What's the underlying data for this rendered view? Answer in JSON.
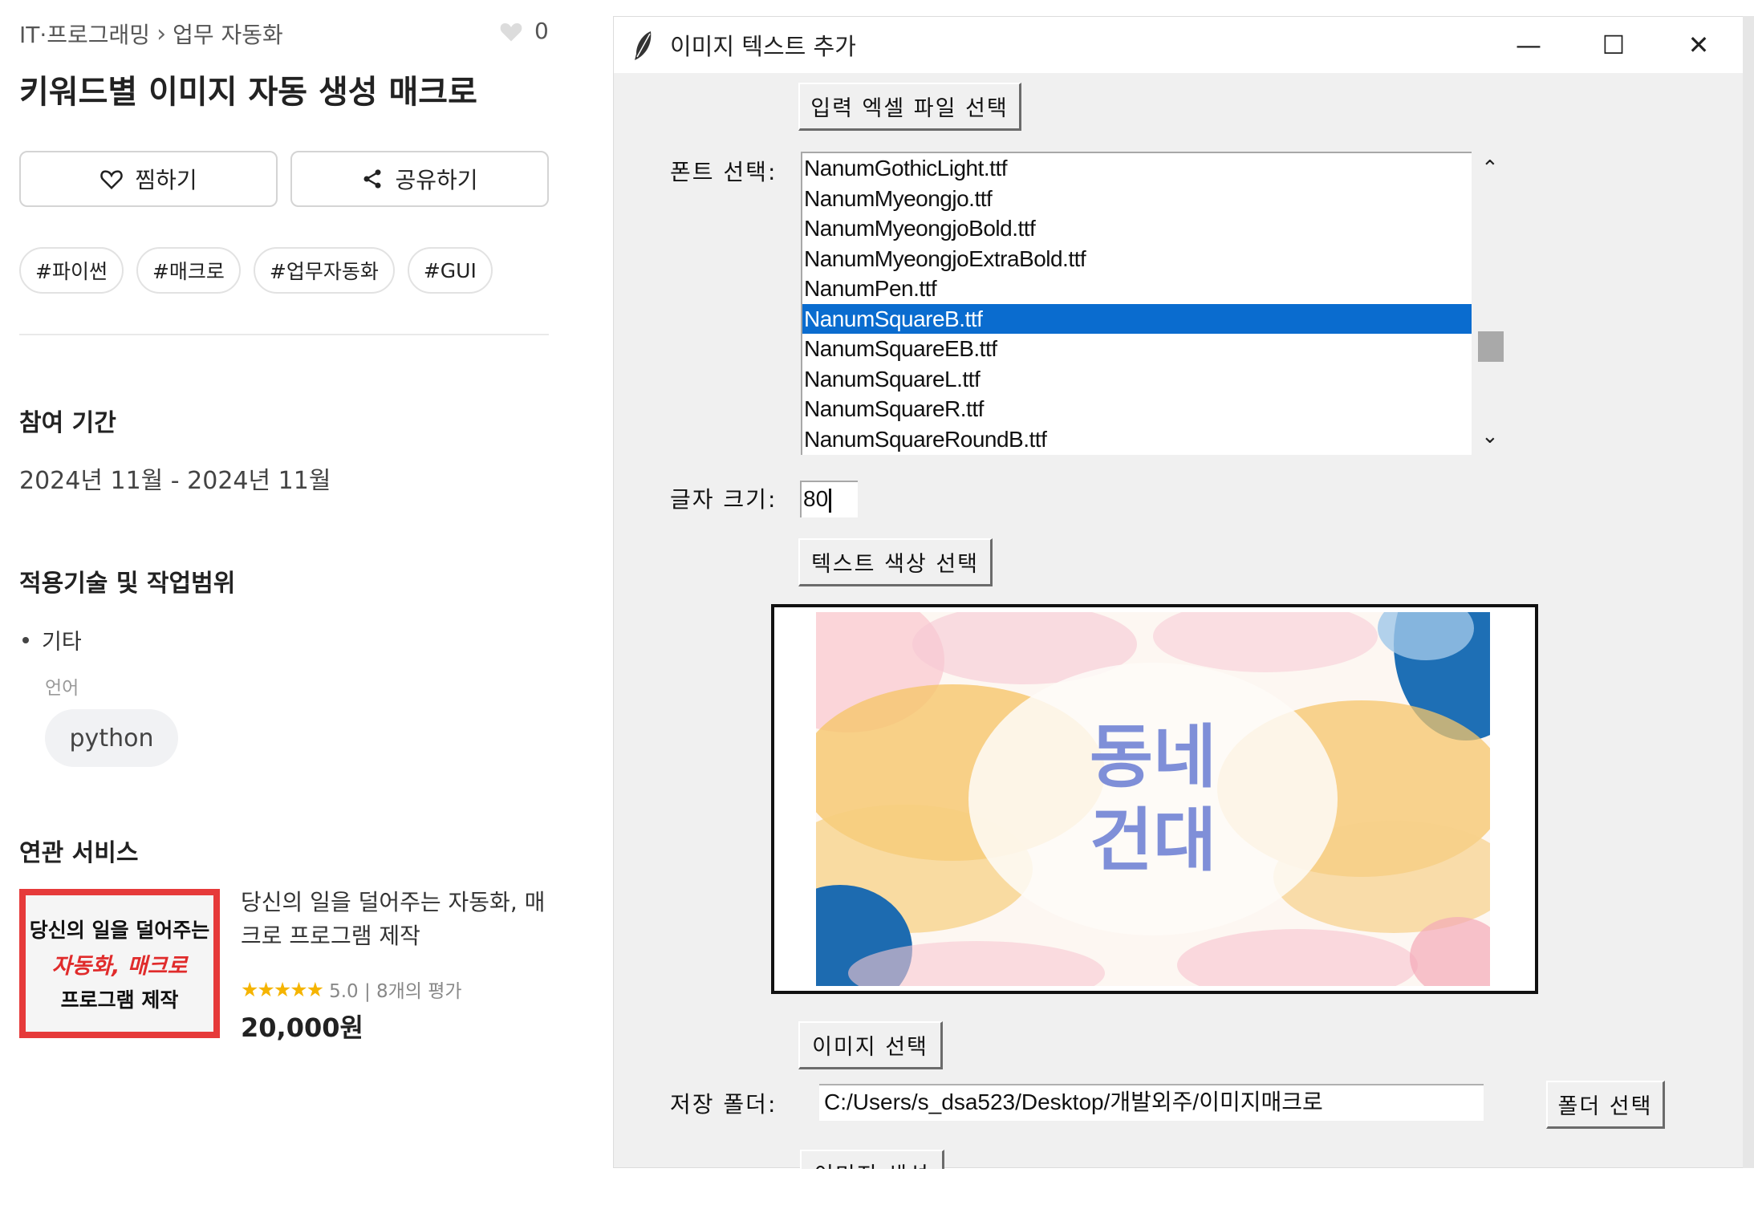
{
  "web": {
    "breadcrumb": {
      "category": "IT·프로그래밍",
      "subcategory": "업무 자동화"
    },
    "like_count": "0",
    "title": "키워드별 이미지 자동 생성 매크로",
    "buttons": {
      "wish": "찜하기",
      "share": "공유하기"
    },
    "tags": [
      "#파이썬",
      "#매크로",
      "#업무자동화",
      "#GUI"
    ],
    "period_heading": "참여 기간",
    "period_value": "2024년 11월 - 2024년 11월",
    "tech_heading": "적용기술 및 작업범위",
    "tech_item": "기타",
    "language_label": "언어",
    "language_value": "python",
    "related_heading": "연관 서비스",
    "related": {
      "thumb_line1": "당신의 일을 덜어주는",
      "thumb_line2": "자동화, 매크로",
      "thumb_line3": "프로그램 제작",
      "title": "당신의 일을 덜어주는 자동화, 매크로 프로그램 제작",
      "stars": "★★★★★",
      "rating": "5.0 | 8개의 평가",
      "price": "20,000원"
    }
  },
  "app": {
    "window_title": "이미지 텍스트 추가",
    "controls": {
      "minimize": "—",
      "maximize": "☐",
      "close": "✕"
    },
    "btn_select_excel": "입력 엑셀 파일 선택",
    "font_label": "폰트 선택:",
    "fonts": [
      "NanumGothicLight.ttf",
      "NanumMyeongjo.ttf",
      "NanumMyeongjoBold.ttf",
      "NanumMyeongjoExtraBold.ttf",
      "NanumPen.ttf",
      "NanumSquareB.ttf",
      "NanumSquareEB.ttf",
      "NanumSquareL.ttf",
      "NanumSquareR.ttf",
      "NanumSquareRoundB.ttf"
    ],
    "selected_font": "NanumSquareB.ttf",
    "size_label": "글자 크기:",
    "size_value": "80",
    "btn_text_color": "텍스트 색상 선택",
    "preview_line1": "동네",
    "preview_line2": "건대",
    "preview_text_color": "#7f8fd8",
    "btn_select_image": "이미지 선택",
    "folder_label": "저장 폴더:",
    "folder_value": "C:/Users/s_dsa523/Desktop/개발외주/이미지매크로",
    "btn_select_folder": "폴더 선택",
    "partial_button": "이미지 생성"
  }
}
